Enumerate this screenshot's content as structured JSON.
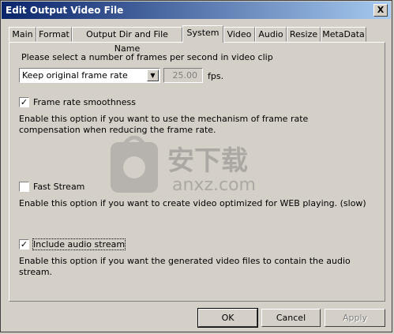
{
  "window": {
    "title": "Edit Output Video File",
    "close_label": "X"
  },
  "tabs": [
    {
      "label": "Main"
    },
    {
      "label": "Format"
    },
    {
      "label": "Output Dir and File Name"
    },
    {
      "label": "System"
    },
    {
      "label": "Video"
    },
    {
      "label": "Audio"
    },
    {
      "label": "Resize"
    },
    {
      "label": "MetaData"
    }
  ],
  "system": {
    "fps_prompt": "Please select a number of frames per second in video clip",
    "fps_mode": "Keep original frame rate",
    "fps_value": "25.00",
    "fps_unit": "fps.",
    "smooth": {
      "label": "Frame rate smoothness",
      "checked": true,
      "description": "Enable this option if you want to use the mechanism of frame rate compensation when reducing the frame rate."
    },
    "fast": {
      "label": "Fast Stream",
      "checked": false,
      "description": "Enable this option if you want to create video optimized for WEB playing. (slow)"
    },
    "audio": {
      "label": "Include audio stream",
      "checked": true,
      "description": "Enable this option if you want the generated video files to contain the audio stream."
    }
  },
  "watermark": {
    "text": "安下载",
    "subtext": "anxz.com"
  },
  "buttons": {
    "ok": "OK",
    "cancel": "Cancel",
    "apply": "Apply"
  }
}
